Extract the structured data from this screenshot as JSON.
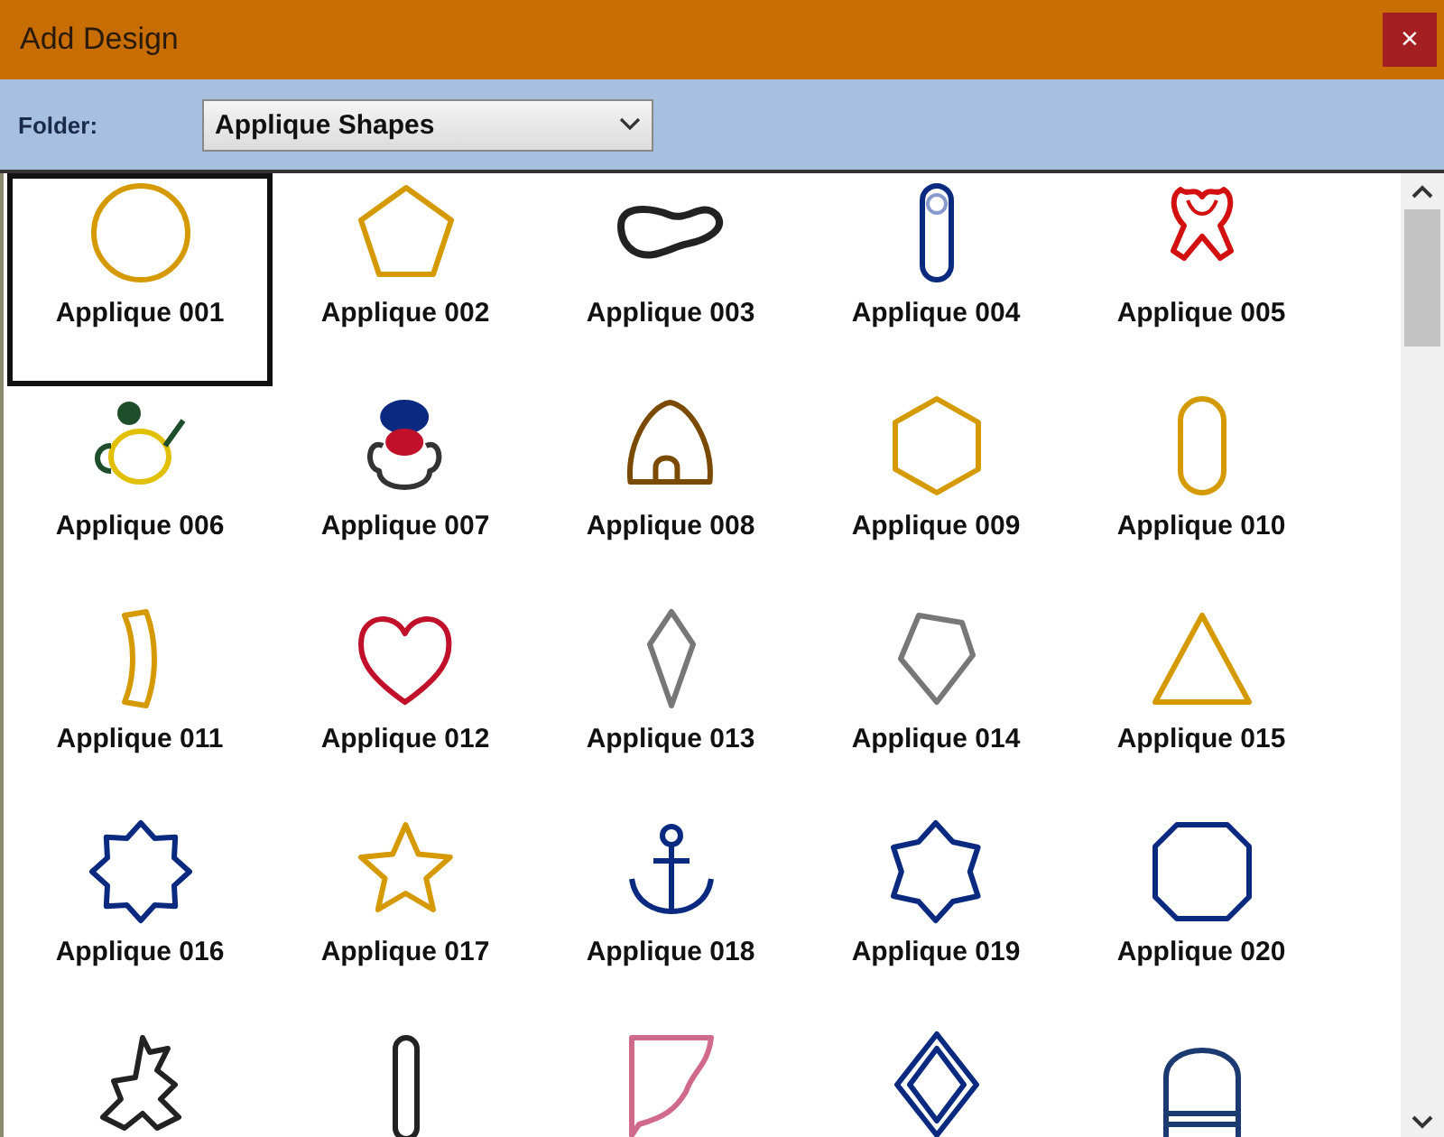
{
  "window": {
    "title": "Add Design",
    "close": "×"
  },
  "folder": {
    "label": "Folder:",
    "value": "Applique Shapes"
  },
  "designs": [
    {
      "label": "Applique 001",
      "kind": "circle",
      "color": "#d49a00",
      "selected": true
    },
    {
      "label": "Applique 002",
      "kind": "pentagon",
      "color": "#d49a00",
      "selected": false
    },
    {
      "label": "Applique 003",
      "kind": "blob",
      "color": "#222222",
      "selected": false
    },
    {
      "label": "Applique 004",
      "kind": "pin",
      "color": "#0a2a80",
      "selected": false
    },
    {
      "label": "Applique 005",
      "kind": "ribbon",
      "color": "#d21010",
      "selected": false
    },
    {
      "label": "Applique 006",
      "kind": "teapot",
      "color": "#e0c000",
      "selected": false
    },
    {
      "label": "Applique 007",
      "kind": "character",
      "color": "#333333",
      "selected": false
    },
    {
      "label": "Applique 008",
      "kind": "hut",
      "color": "#7a4a00",
      "selected": false
    },
    {
      "label": "Applique 009",
      "kind": "hexagon",
      "color": "#d49a00",
      "selected": false
    },
    {
      "label": "Applique 010",
      "kind": "capsule",
      "color": "#d49a00",
      "selected": false
    },
    {
      "label": "Applique 011",
      "kind": "arc",
      "color": "#d49a00",
      "selected": false
    },
    {
      "label": "Applique 012",
      "kind": "heart",
      "color": "#c0102a",
      "selected": false
    },
    {
      "label": "Applique 013",
      "kind": "kite",
      "color": "#777777",
      "selected": false
    },
    {
      "label": "Applique 014",
      "kind": "shield",
      "color": "#777777",
      "selected": false
    },
    {
      "label": "Applique 015",
      "kind": "triangle",
      "color": "#d49a00",
      "selected": false
    },
    {
      "label": "Applique 016",
      "kind": "octastar",
      "color": "#0a2a80",
      "selected": false
    },
    {
      "label": "Applique 017",
      "kind": "star",
      "color": "#d49a00",
      "selected": false
    },
    {
      "label": "Applique 018",
      "kind": "anchor",
      "color": "#0a2a80",
      "selected": false
    },
    {
      "label": "Applique 019",
      "kind": "flower",
      "color": "#0a2a80",
      "selected": false
    },
    {
      "label": "Applique 020",
      "kind": "octagon",
      "color": "#0a2a80",
      "selected": false
    },
    {
      "kind": "dragon",
      "color": "#222222",
      "selected": false
    },
    {
      "kind": "slim",
      "color": "#222222",
      "selected": false
    },
    {
      "kind": "corner",
      "color": "#d06a8a",
      "selected": false
    },
    {
      "kind": "diamond",
      "color": "#0a2a80",
      "selected": false
    },
    {
      "kind": "arch",
      "color": "#1a3a70",
      "selected": false
    }
  ]
}
